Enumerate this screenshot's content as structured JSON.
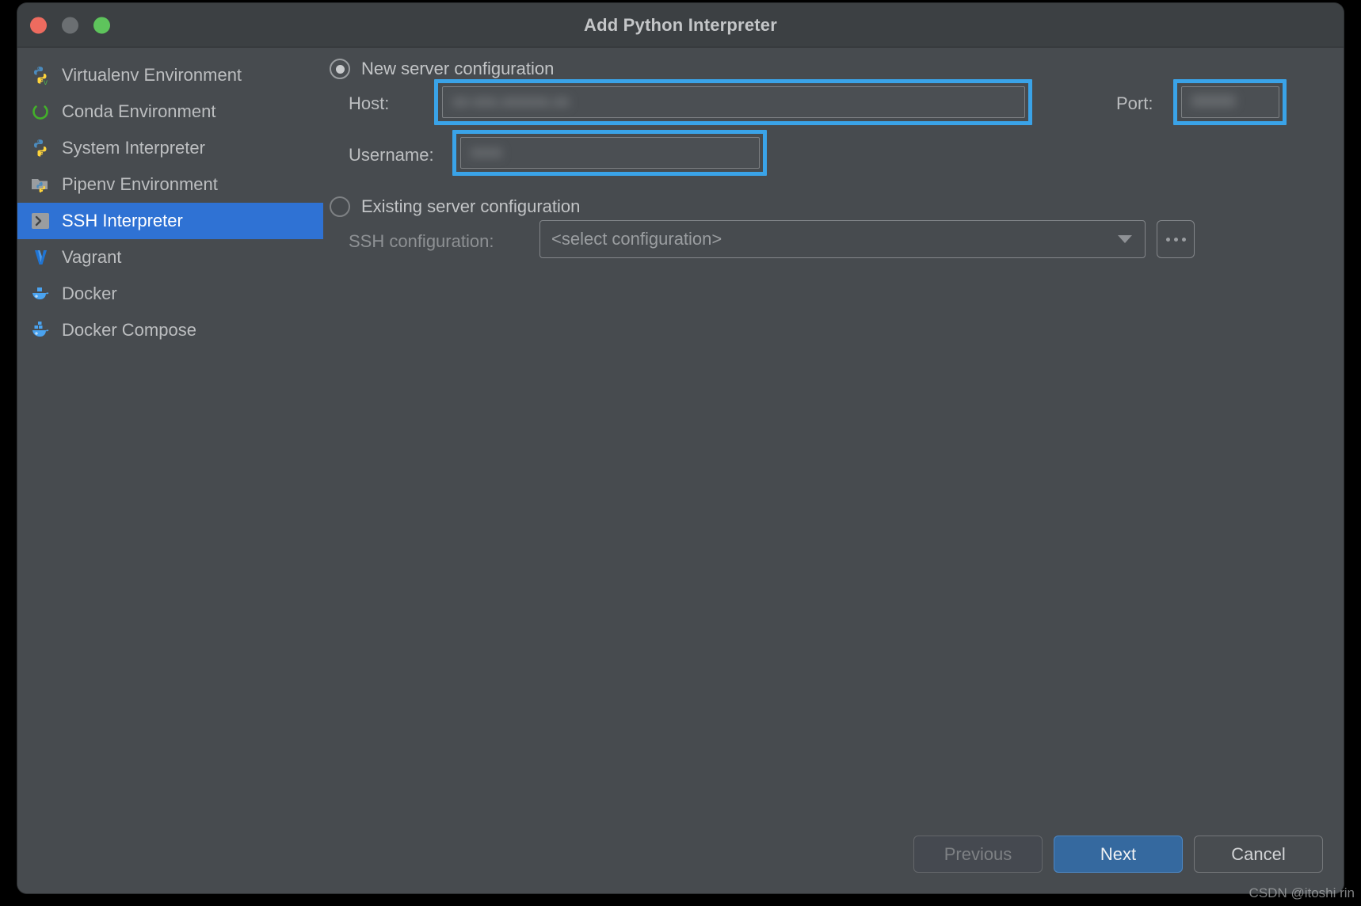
{
  "window": {
    "title": "Add Python Interpreter",
    "traffic_lights": [
      {
        "name": "close",
        "color": "#ed6b5f"
      },
      {
        "name": "minimize",
        "color": "#6b6f72"
      },
      {
        "name": "zoom",
        "color": "#5ec45c"
      }
    ]
  },
  "sidebar": {
    "items": [
      {
        "label": "Virtualenv Environment",
        "icon": "python-virtualenv-icon",
        "selected": false
      },
      {
        "label": "Conda Environment",
        "icon": "conda-icon",
        "selected": false
      },
      {
        "label": "System Interpreter",
        "icon": "python-icon",
        "selected": false
      },
      {
        "label": "Pipenv Environment",
        "icon": "pipenv-folder-icon",
        "selected": false
      },
      {
        "label": "SSH Interpreter",
        "icon": "ssh-terminal-icon",
        "selected": true
      },
      {
        "label": "Vagrant",
        "icon": "vagrant-icon",
        "selected": false
      },
      {
        "label": "Docker",
        "icon": "docker-whale-icon",
        "selected": false
      },
      {
        "label": "Docker Compose",
        "icon": "docker-compose-icon",
        "selected": false
      }
    ]
  },
  "main": {
    "new_server": {
      "radio_label": "New server configuration",
      "selected": true,
      "host": {
        "label": "Host:",
        "value": "",
        "redacted": true
      },
      "port": {
        "label": "Port:",
        "value": "",
        "redacted": true
      },
      "username": {
        "label": "Username:",
        "value": "",
        "redacted": true
      }
    },
    "existing_server": {
      "radio_label": "Existing server configuration",
      "selected": false,
      "ssh_config": {
        "label": "SSH configuration:",
        "placeholder": "<select configuration>",
        "value": "<select configuration>",
        "browse_label": "..."
      }
    }
  },
  "footer": {
    "previous_label": "Previous",
    "next_label": "Next",
    "cancel_label": "Cancel"
  },
  "watermark": {
    "text": "CSDN @itoshi rin"
  },
  "colors": {
    "accent_selection": "#2f72d4",
    "annotation_highlight": "#3aa3e8",
    "primary_button": "#35699f",
    "window_bg": "#474b4f",
    "titlebar_bg": "#3c4043"
  }
}
